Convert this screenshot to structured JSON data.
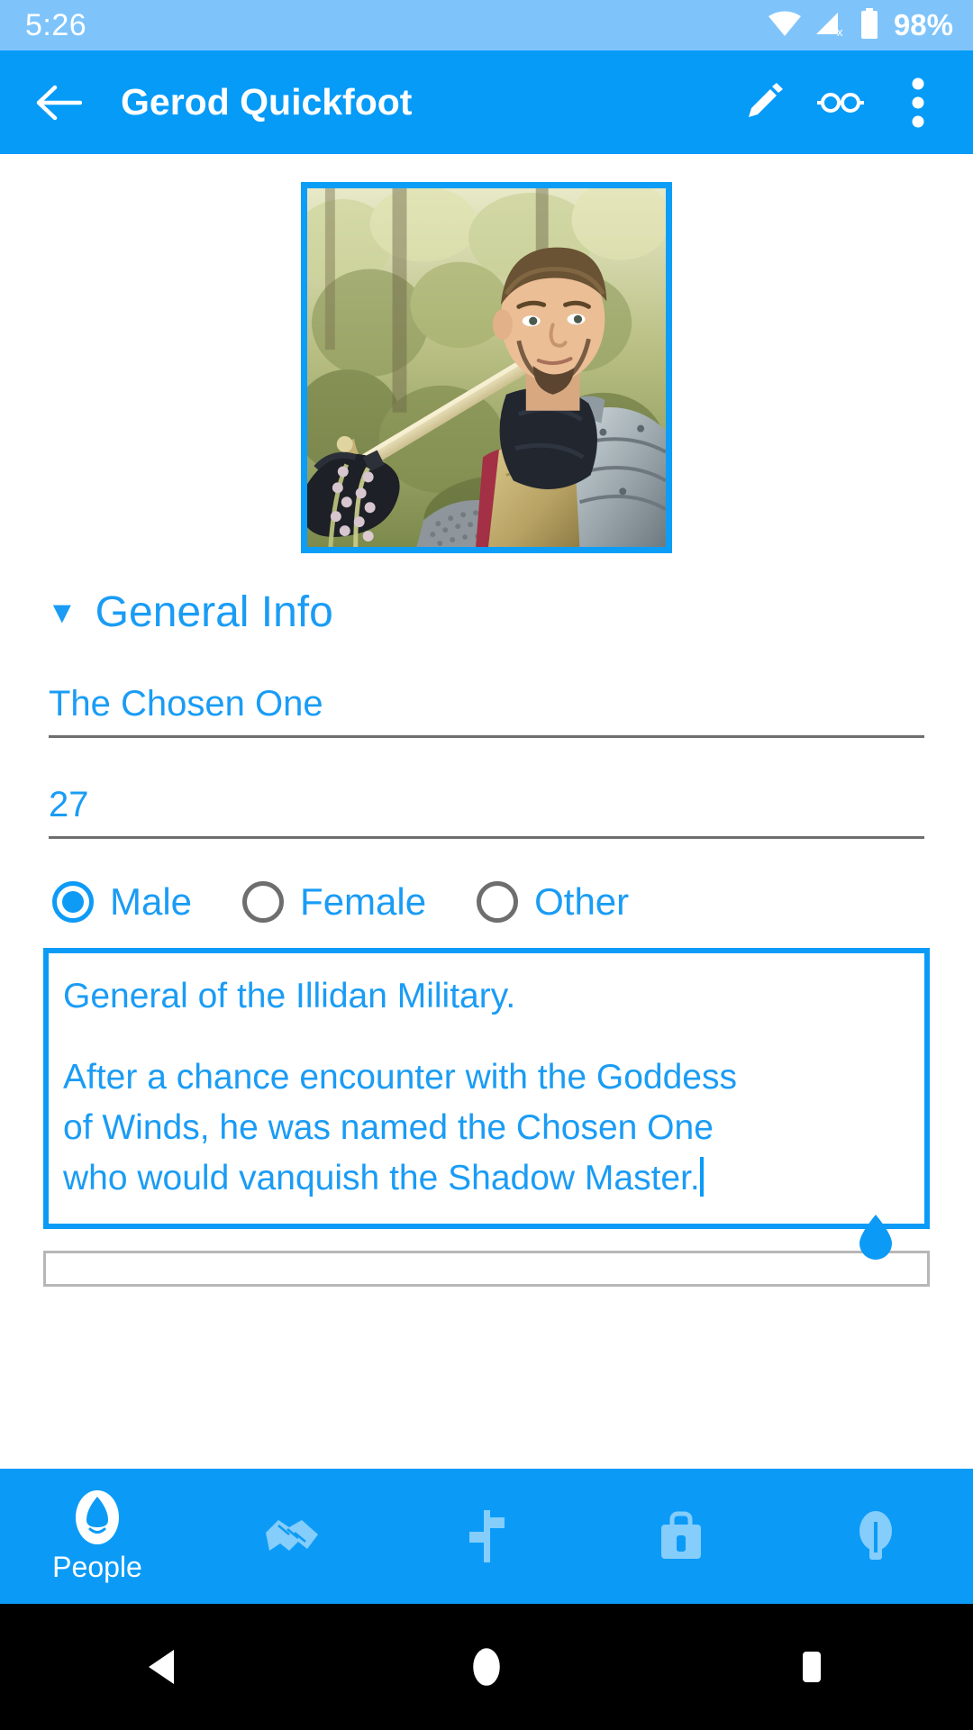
{
  "status_bar": {
    "clock": "5:26",
    "battery_percent": "98%",
    "icons": [
      "wifi-icon",
      "cellular-no-signal-icon",
      "battery-icon"
    ]
  },
  "toolbar": {
    "back_icon": "arrow-back-icon",
    "title": "Gerod Quickfoot",
    "actions": [
      {
        "name": "edit-icon",
        "label": "Edit"
      },
      {
        "name": "glasses-icon",
        "label": "View Mode"
      },
      {
        "name": "overflow-menu-icon",
        "label": "More options"
      }
    ]
  },
  "portrait": {
    "alt": "Knight in armor holding a sword over his shoulder",
    "border_color": "#0c9ef7"
  },
  "section": {
    "caret": "▼",
    "title": "General Info",
    "expanded": true
  },
  "fields": [
    {
      "name": "title-field",
      "value": "The Chosen One"
    },
    {
      "name": "age-field",
      "value": "27"
    }
  ],
  "gender": {
    "selected": "Male",
    "options": [
      {
        "label": "Male",
        "checked": true
      },
      {
        "label": "Female",
        "checked": false
      },
      {
        "label": "Other",
        "checked": false
      }
    ]
  },
  "bio": {
    "focused": true,
    "lines": [
      "General of the Illidan Military.",
      "",
      "After a chance encounter with the Goddess",
      "of Winds, he was named the Chosen One",
      "who would vanquish the Shadow Master."
    ],
    "line1": "General of the Illidan Military.",
    "line2": "After a chance encounter with the Goddess",
    "line3": "of Winds, he was named the Chosen One",
    "line4": "who would vanquish the Shadow Master.",
    "handle_icon": "text-cursor-handle-icon"
  },
  "bottom_nav": {
    "active": "People",
    "items": [
      {
        "icon": "people-icon",
        "label": "People",
        "active": true
      },
      {
        "icon": "handshake-icon",
        "label": "",
        "active": false
      },
      {
        "icon": "signpost-icon",
        "label": "",
        "active": false
      },
      {
        "icon": "briefcase-icon",
        "label": "",
        "active": false
      },
      {
        "icon": "lightbulb-icon",
        "label": "",
        "active": false
      }
    ]
  },
  "android_nav": {
    "buttons": [
      {
        "name": "back-icon",
        "label": "Back"
      },
      {
        "name": "home-icon",
        "label": "Home"
      },
      {
        "name": "recents-icon",
        "label": "Recents"
      }
    ]
  },
  "colors": {
    "primary": "#069bf7",
    "status_bar": "#7ec4fb",
    "accent_text": "#1a9cf5",
    "underline": "#6e6e6e"
  }
}
